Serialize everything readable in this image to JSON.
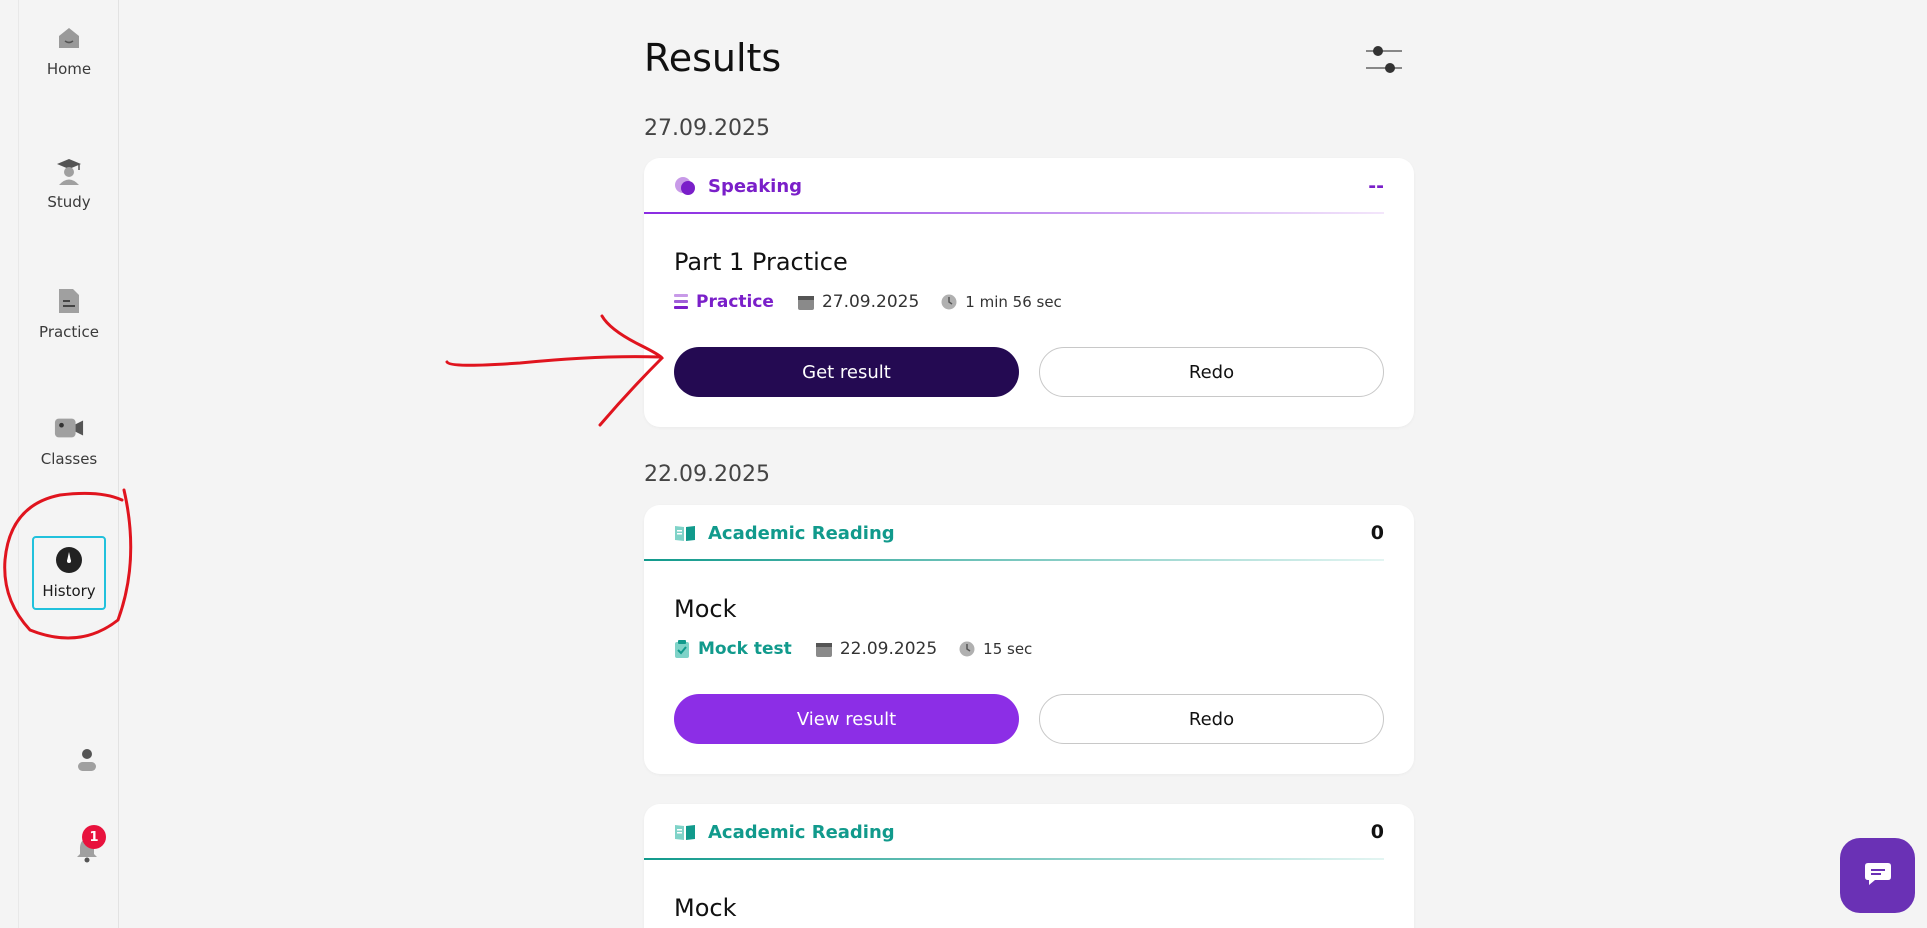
{
  "sidebar": {
    "items": [
      {
        "label": "Home",
        "icon": "home-icon"
      },
      {
        "label": "Study",
        "icon": "graduation-cap-icon"
      },
      {
        "label": "Practice",
        "icon": "document-icon"
      },
      {
        "label": "Classes",
        "icon": "video-camera-icon"
      },
      {
        "label": "History",
        "icon": "clock-icon",
        "active": true
      }
    ],
    "notification_count": "1"
  },
  "main": {
    "title": "Results",
    "groups": [
      {
        "date": "27.09.2025",
        "cards": [
          {
            "type": "Speaking",
            "score": "--",
            "title": "Part 1 Practice",
            "tag": "Practice",
            "date": "27.09.2025",
            "duration": "1 min 56 sec",
            "primary_label": "Get result",
            "secondary_label": "Redo"
          }
        ]
      },
      {
        "date": "22.09.2025",
        "cards": [
          {
            "type": "Academic Reading",
            "score": "0",
            "title": "Mock",
            "tag": "Mock test",
            "date": "22.09.2025",
            "duration": "15 sec",
            "primary_label": "View result",
            "secondary_label": "Redo"
          },
          {
            "type": "Academic Reading",
            "score": "0",
            "title": "Mock"
          }
        ]
      }
    ]
  },
  "colors": {
    "speaking": "#7a1fc9",
    "reading": "#119a8c",
    "dark_button": "#240a52",
    "purple_button": "#8c2ee6",
    "active_border": "#21c1dc",
    "annotation": "#e0141e"
  }
}
